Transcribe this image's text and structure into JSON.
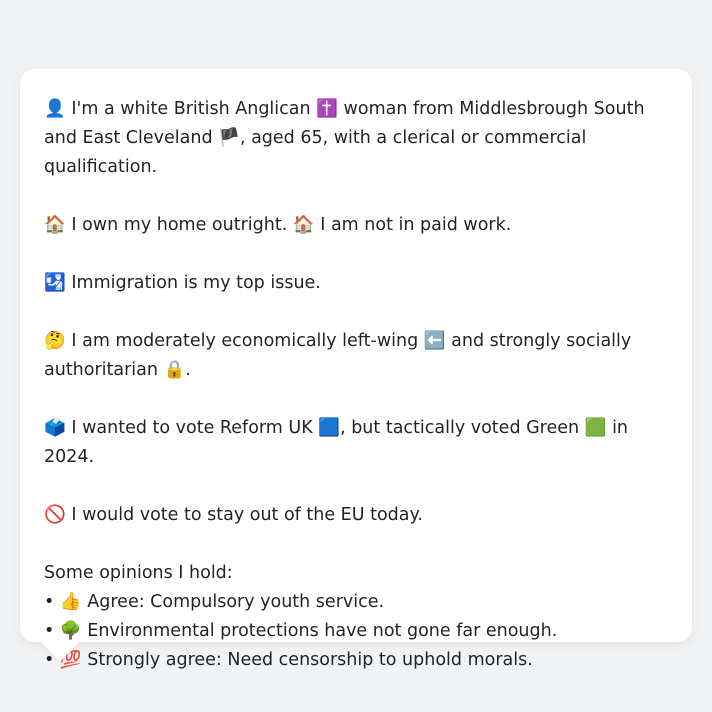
{
  "persona": {
    "intro": {
      "icon": "👤",
      "text_a": "I'm a white British Anglican",
      "icon_b": "✝️",
      "text_b": "woman from Middlesbrough South and East Cleveland",
      "icon_c": "🏴",
      "text_c": ", aged 65, with a clerical or commercial qualification."
    },
    "home": {
      "icon": "🏠",
      "text_a": "I own my home outright.",
      "icon_b": "🏠",
      "text_b": "I am not in paid work."
    },
    "issue": {
      "icon": "🛂",
      "text": "Immigration is my top issue."
    },
    "politics": {
      "icon": "🤔",
      "text_a": "I am moderately economically left-wing",
      "icon_b": "⬅️",
      "text_b": "and strongly socially authoritarian",
      "icon_c": "🔒",
      "text_c": "."
    },
    "vote": {
      "icon": "🗳️",
      "text_a": "I wanted to vote Reform UK",
      "icon_b": "🟦",
      "text_b": ", but tactically voted Green",
      "icon_c": "🟩",
      "text_c": "in 2024."
    },
    "eu": {
      "icon": "🚫",
      "text": "I would vote to stay out of the EU today."
    },
    "opinions": {
      "heading": "Some opinions I hold:",
      "items": [
        {
          "bullet": "•",
          "icon": "👍",
          "text": "Agree: Compulsory youth service."
        },
        {
          "bullet": "•",
          "icon": "🌳",
          "text": "Environmental protections have not gone far enough."
        },
        {
          "bullet": "•",
          "icon": "💯",
          "text": "Strongly agree: Need censorship to uphold morals."
        }
      ]
    }
  },
  "colors": {
    "background": "#f1f3f5",
    "card": "#ffffff",
    "text": "#1f2328"
  }
}
